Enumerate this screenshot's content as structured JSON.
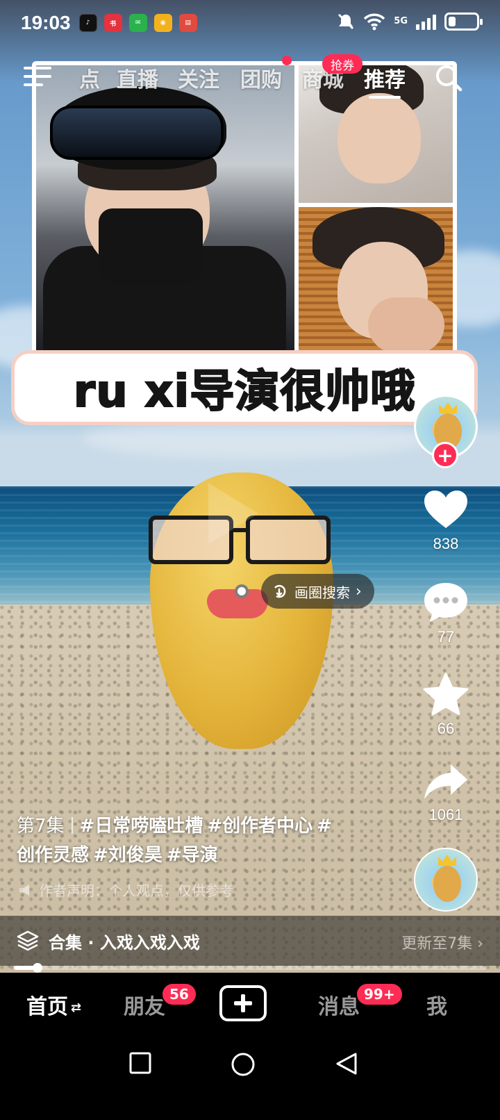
{
  "status_bar": {
    "time": "19:03",
    "app_icons": [
      "tiktok-icon",
      "xiaohongshu-icon",
      "wechat-icon",
      "weibo-icon",
      "reader-icon"
    ],
    "network": "5G"
  },
  "top_nav": {
    "tabs": [
      "点",
      "直播",
      "关注",
      "团购",
      "商城",
      "推荐"
    ],
    "active_tab": "推荐",
    "mall_badge": "抢券"
  },
  "video": {
    "sticker_text": "ru xi导演很帅哦",
    "circle_search_label": "画圈搜索"
  },
  "actions": {
    "likes": "838",
    "comments": "77",
    "favorites": "66",
    "shares": "1061"
  },
  "caption": {
    "episode": "第7集",
    "tags": [
      "#日常唠嗑吐槽",
      "#创作者中心",
      "#",
      "创作灵感",
      "#刘俊昊",
      "#导演"
    ],
    "disclaimer": "作者声明：个人观点，仅供参考"
  },
  "collection": {
    "title": "合集 · 入戏入戏入戏",
    "update": "更新至7集"
  },
  "progress": {
    "fraction": 0.05
  },
  "bottom_tabs": {
    "home": "首页",
    "friends": "朋友",
    "friends_badge": "56",
    "messages": "消息",
    "messages_badge": "99+",
    "me": "我"
  },
  "colors": {
    "accent": "#fe2c55",
    "tab_active": "#ffffff"
  }
}
